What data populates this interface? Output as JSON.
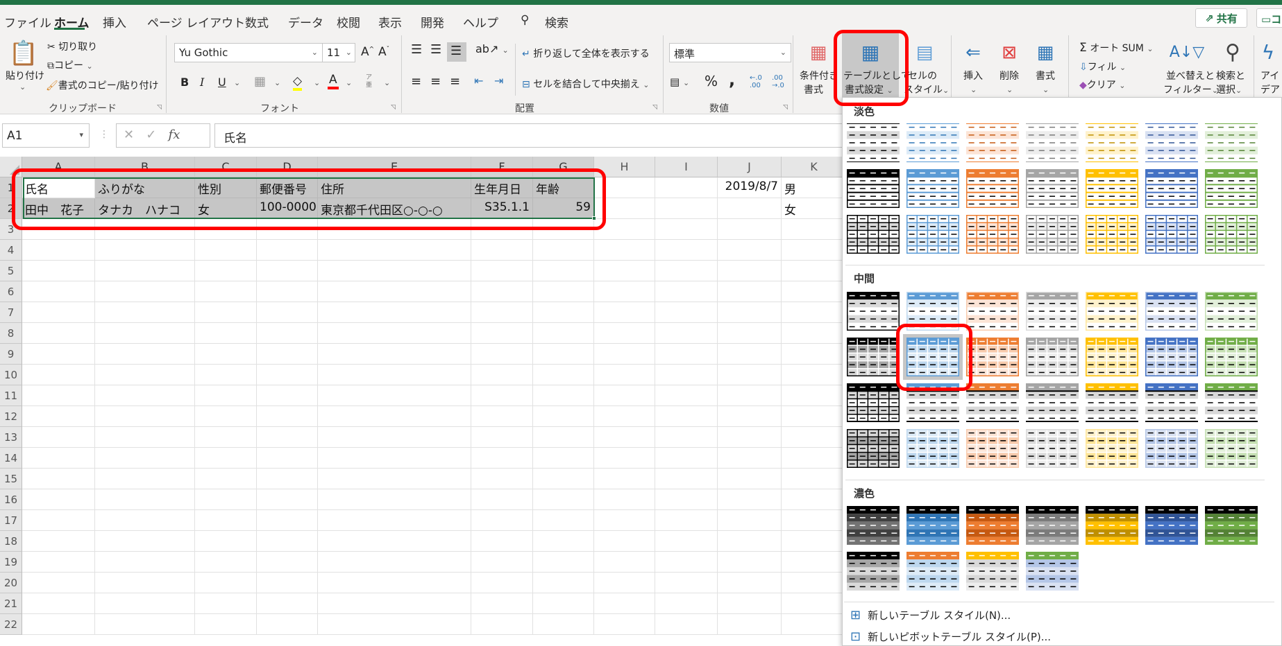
{
  "tabs": [
    "ファイル",
    "ホーム",
    "挿入",
    "ページ レイアウト",
    "数式",
    "データ",
    "校閲",
    "表示",
    "開発",
    "ヘルプ"
  ],
  "active_tab": "ホーム",
  "search_label": "検索",
  "share_label": "共有",
  "comment_label": "コ",
  "clipboard": {
    "paste": "貼り付け",
    "cut": "切り取り",
    "copy": "コピー",
    "format_painter": "書式のコピー/貼り付け",
    "group": "クリップボード"
  },
  "font": {
    "name": "Yu Gothic",
    "size": "11",
    "bold": "B",
    "italic": "I",
    "underline": "U",
    "font_color_glyph": "A",
    "phonetic_glyph": "ア亜",
    "grow": "A",
    "shrink": "A",
    "group": "フォント"
  },
  "alignment": {
    "wrap": "折り返して全体を表示する",
    "merge": "セルを結合して中央揃え",
    "group": "配置"
  },
  "number": {
    "format": "標準",
    "percent": "%",
    "comma": ",",
    "dec_increase": "←.0 .00",
    "dec_decrease": ".00 →.0",
    "group": "数値"
  },
  "styles": {
    "conditional": [
      "条件付き",
      "書式"
    ],
    "table": [
      "テーブルとして",
      "書式設定"
    ],
    "cell": [
      "セルの",
      "スタイル"
    ]
  },
  "cells": {
    "insert": "挿入",
    "delete": "削除",
    "format": "書式"
  },
  "editing": {
    "autosum": "オート SUM",
    "fill": "フィル",
    "clear": "クリア",
    "sort": [
      "並べ替えと",
      "フィルター"
    ],
    "find": [
      "検索と",
      "選択"
    ],
    "ideas": [
      "アイ",
      "デア"
    ]
  },
  "formula_bar": {
    "name_box": "A1",
    "fx": "fx",
    "value": "氏名"
  },
  "columns": [
    "A",
    "B",
    "C",
    "D",
    "E",
    "F",
    "G",
    "H",
    "I",
    "J",
    "K"
  ],
  "rows": [
    "1",
    "2",
    "3",
    "4",
    "5",
    "6",
    "7",
    "8",
    "9",
    "10",
    "11",
    "12",
    "13",
    "14",
    "15",
    "16",
    "17",
    "18",
    "19",
    "20",
    "21",
    "22"
  ],
  "sheet": {
    "row1": [
      "氏名",
      "ふりがな",
      "性別",
      "郵便番号",
      "住所",
      "生年月日",
      "年齢",
      "",
      "",
      "2019/8/7",
      "男"
    ],
    "row2": [
      "田中　花子",
      "タナカ　ハナコ",
      "女",
      "100-0000",
      "東京都千代田区○-○-○",
      "S35.1.1",
      "59",
      "",
      "",
      "",
      "女"
    ]
  },
  "gallery": {
    "sections": [
      {
        "label": "淡色",
        "rows": [
          "light-banded",
          "light-header",
          "light-grid"
        ]
      },
      {
        "label": "中間",
        "rows": [
          "medium-banded",
          "medium-grid",
          "medium-gray",
          "medium-grid-nohdr"
        ]
      },
      {
        "label": "濃色",
        "rows": [
          "dark-banded",
          "dark-mixed"
        ]
      }
    ],
    "selected": {
      "section": "中間",
      "row": 2,
      "col": 2
    },
    "palettes": [
      {
        "main": "#000000",
        "light": "#D9D9D9",
        "mid": "#A6A6A6",
        "dark": "#404040",
        "dark2": "#737373"
      },
      {
        "main": "#5B9BD5",
        "light": "#DDEBF7",
        "mid": "#BDD7EE",
        "dark": "#2F75B5",
        "dark2": "#5B9BD5"
      },
      {
        "main": "#ED7D31",
        "light": "#FCE4D6",
        "mid": "#F8CBAD",
        "dark": "#C65911",
        "dark2": "#ED7D31"
      },
      {
        "main": "#A5A5A5",
        "light": "#EDEDED",
        "mid": "#DBDBDB",
        "dark": "#7B7B7B",
        "dark2": "#A5A5A5"
      },
      {
        "main": "#FFC000",
        "light": "#FFF2CC",
        "mid": "#FFE699",
        "dark": "#BF8F00",
        "dark2": "#FFC000"
      },
      {
        "main": "#4472C4",
        "light": "#D9E1F2",
        "mid": "#B4C6E7",
        "dark": "#305496",
        "dark2": "#4472C4"
      },
      {
        "main": "#70AD47",
        "light": "#E2EFDA",
        "mid": "#C6E0B4",
        "dark": "#548235",
        "dark2": "#70AD47"
      }
    ],
    "dark_mixed": [
      {
        "main": "#000000",
        "light": "#D9D9D9",
        "mid": "#A6A6A6"
      },
      {
        "main": "#ED7D31",
        "light": "#DDEBF7",
        "mid": "#BDD7EE"
      },
      {
        "main": "#FFC000",
        "light": "#EDEDED",
        "mid": "#D9D9D9"
      },
      {
        "main": "#70AD47",
        "light": "#D9E1F2",
        "mid": "#B4C6E7"
      }
    ],
    "new_table_style": "新しいテーブル スタイル(N)...",
    "new_pivot_style": "新しいピボットテーブル スタイル(P)..."
  },
  "colors": {
    "excel_green": "#217346",
    "annotation_red": "#FF0000",
    "selection_fill": "#C6C6C6"
  }
}
